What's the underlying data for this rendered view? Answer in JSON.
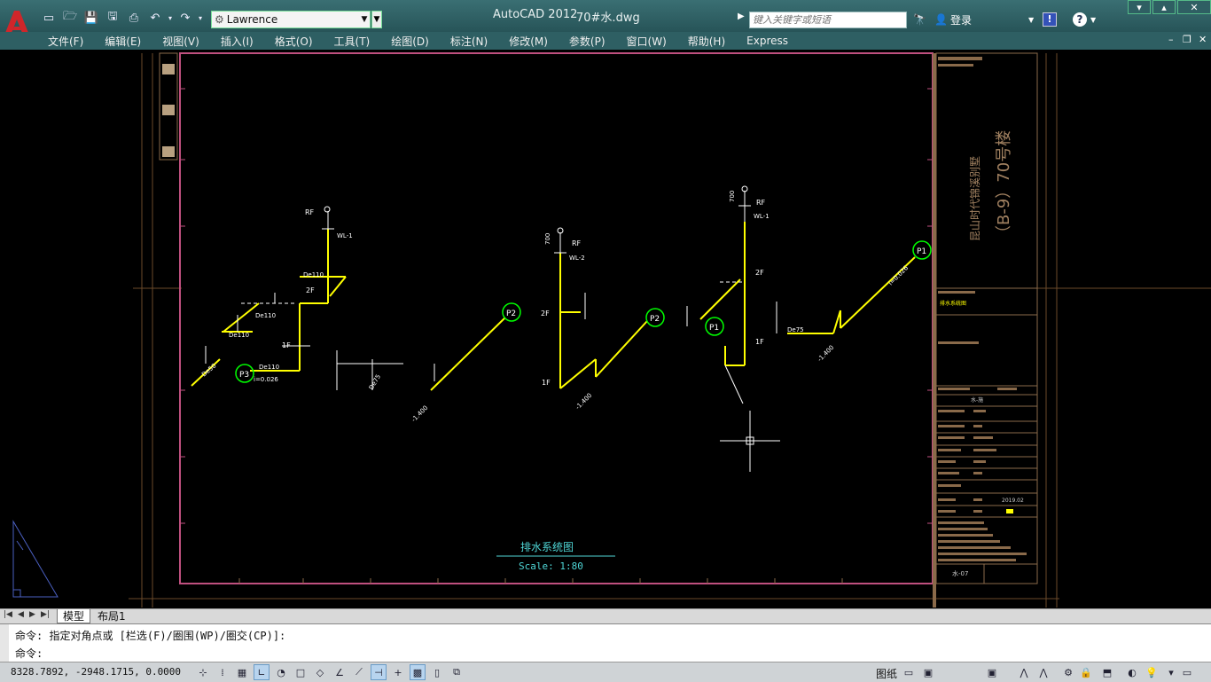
{
  "app": {
    "title": "AutoCAD 2012",
    "document": "70#水.dwg",
    "workspace": "Lawrence",
    "search_placeholder": "键入关键字或短语",
    "login_label": "登录"
  },
  "menu": {
    "items": [
      "文件(F)",
      "编辑(E)",
      "视图(V)",
      "插入(I)",
      "格式(O)",
      "工具(T)",
      "绘图(D)",
      "标注(N)",
      "修改(M)",
      "参数(P)",
      "窗口(W)",
      "帮助(H)",
      "Express"
    ]
  },
  "drawing": {
    "title": "排水系统图",
    "scale": "Scale: 1:80",
    "project_name": "昆山时代锦溪别墅",
    "building": "（B-9）70号楼",
    "sheet_number": "水-07",
    "date": "2019.02",
    "markers": [
      "P1",
      "P2",
      "P3",
      "P1",
      "P2"
    ],
    "labels": {
      "rf": "RF",
      "f2": "2F",
      "f1": "1F",
      "wl1": "WL-1",
      "wl2": "WL-2",
      "h700": "700",
      "de110": "De110",
      "de75": "De75",
      "de50": "De50",
      "slope": "i=0.026",
      "elev": "-1.400"
    },
    "colors": {
      "pipe": "#ffff00",
      "marker": "#00ff00",
      "frame": "#c0507f",
      "text": "#ffffff",
      "title": "#4fd6d6"
    }
  },
  "tabs": {
    "model": "模型",
    "layout1": "布局1"
  },
  "command": {
    "history": "命令: 指定对角点或 [栏选(F)/圈围(WP)/圈交(CP)]:",
    "prompt": "命令:"
  },
  "status": {
    "coords": "8328.7892, -2948.1715, 0.0000",
    "paper_label": "图纸"
  }
}
